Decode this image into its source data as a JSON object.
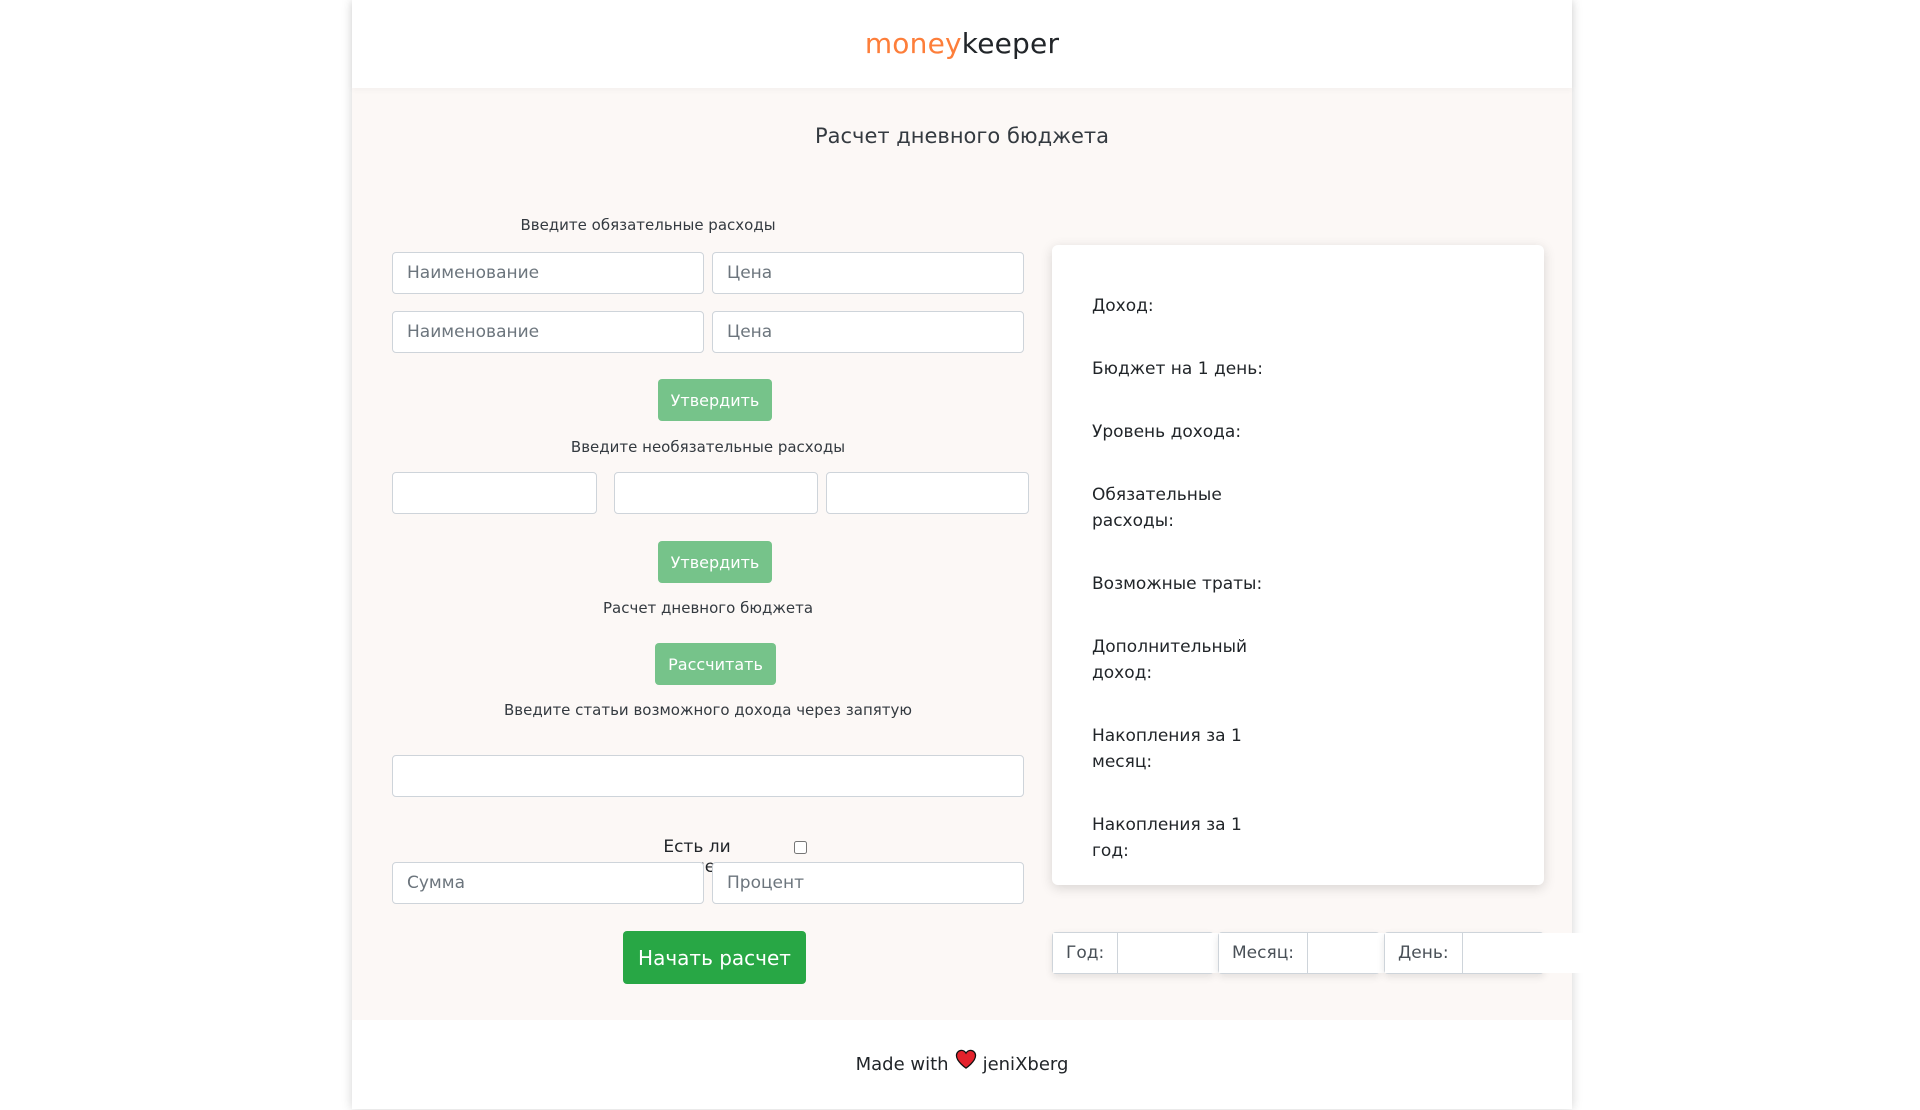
{
  "header": {
    "logo_part1": "money",
    "logo_part2": "keeper",
    "brand_color": "#fd7e3a"
  },
  "main": {
    "title": "Расчет дневного бюджета",
    "mandatory": {
      "label": "Введите обязательные расходы",
      "name_placeholder": "Наименование",
      "price_placeholder": "Цена",
      "submit_label": "Утвердить"
    },
    "optional": {
      "label": "Введите необязательные расходы",
      "submit_label": "Утвердить"
    },
    "daily": {
      "label": "Расчет дневного бюджета",
      "calculate_label": "Рассчитать"
    },
    "income": {
      "label": "Введите статьи возможного дохода через запятую"
    },
    "savings": {
      "label": "Есть ли накопления:",
      "checked": false,
      "sum_placeholder": "Сумма",
      "percent_placeholder": "Процент"
    },
    "start_label": "Начать расчет",
    "button_color": "#28a745",
    "button_light_color": "#76c38a"
  },
  "results": {
    "income": "Доход:",
    "budget_day": "Бюджет на 1 день:",
    "income_level": "Уровень дохода:",
    "mandatory_expenses": "Обязательные расходы:",
    "possible_expenses": "Возможные траты:",
    "additional_income": "Дополнительный доход:",
    "savings_month": "Накопления за 1 месяц:",
    "savings_year": "Накопления за 1 год:"
  },
  "date": {
    "year_label": "Год:",
    "month_label": "Месяц:",
    "day_label": "День:"
  },
  "footer": {
    "made_with": "Made with",
    "author": "jeniXberg",
    "heart_icon": "heart-icon"
  }
}
